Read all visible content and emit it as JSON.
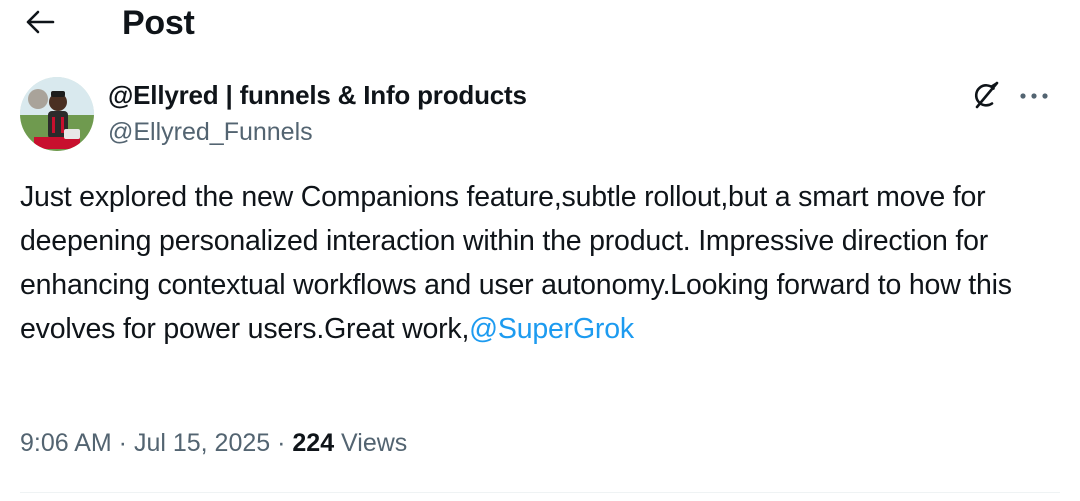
{
  "header": {
    "title": "Post",
    "back_icon": "arrow-left-icon"
  },
  "author": {
    "display_name": "@Ellyred | funnels & Info products",
    "handle": "@Ellyred_Funnels",
    "avatar": "profile-photo"
  },
  "actions": {
    "grok_icon": "grok-icon",
    "more_icon": "more-horizontal-icon"
  },
  "post": {
    "text": "Just explored the new Companions feature,subtle rollout,but a smart move for deepening personalized interaction within the product. Impressive direction for enhancing contextual workflows and user autonomy.Looking forward to how this evolves for power users.Great work,",
    "mention": "@SuperGrok"
  },
  "meta": {
    "time": "9:06 AM",
    "separator_1": " · ",
    "date": "Jul 15, 2025",
    "separator_2": " · ",
    "views_count": "224",
    "views_label": " Views"
  },
  "colors": {
    "text_primary": "#0f1419",
    "text_secondary": "#536471",
    "link": "#1d9bf0",
    "divider": "#eff3f4"
  }
}
